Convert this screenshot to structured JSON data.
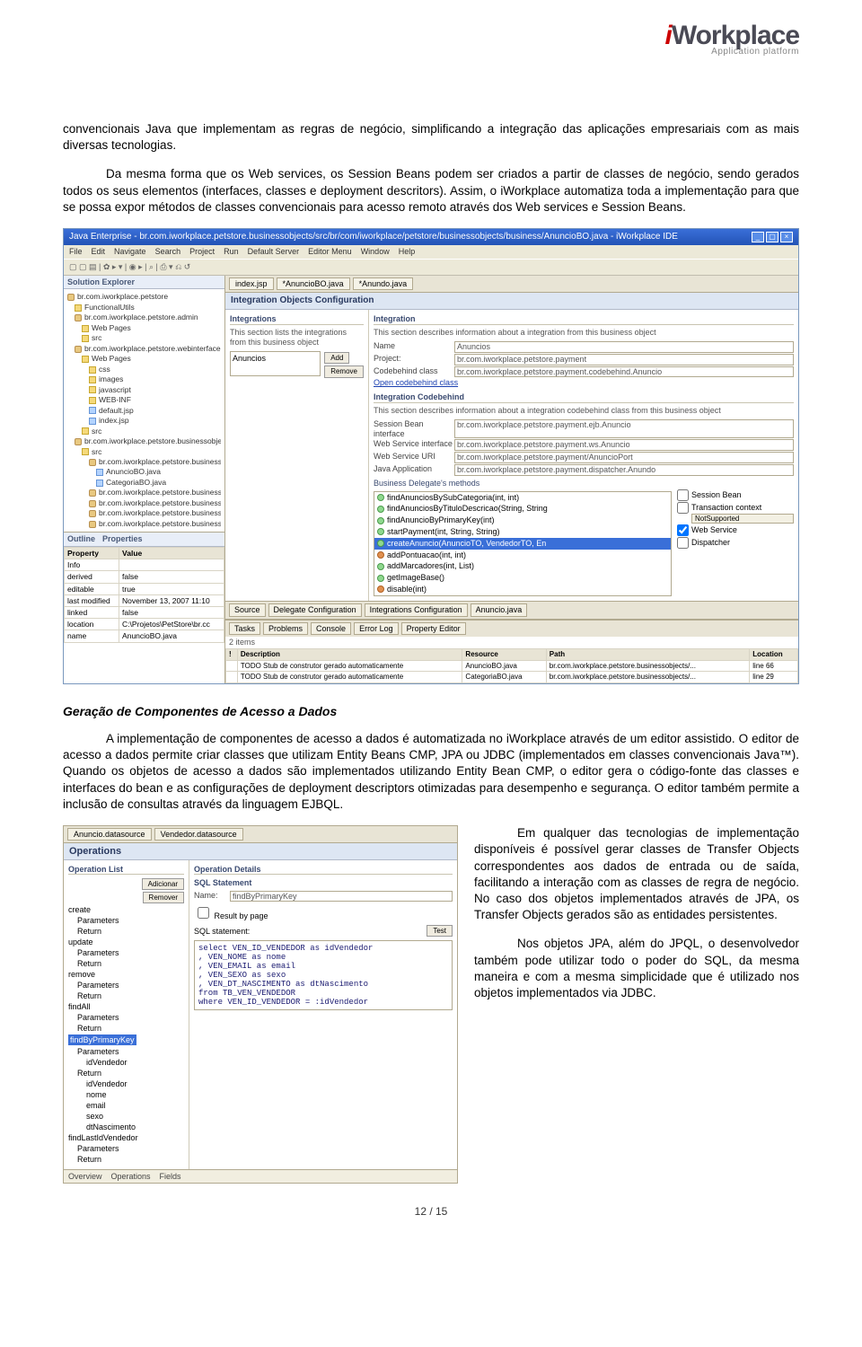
{
  "logo": {
    "text_i": "i",
    "text_rest": "Workplace",
    "sub": "Application   platform"
  },
  "para1": "convencionais Java que implementam as regras de negócio, simplificando a integração das aplicações empresariais com as mais diversas tecnologias.",
  "para2": "Da mesma forma que os Web services, os Session Beans podem ser criados a partir de classes de negócio, sendo gerados todos os seus elementos (interfaces, classes e deployment descritors). Assim, o iWorkplace automatiza toda a implementação para que se possa expor métodos de classes convencionais para acesso remoto através dos Web services e Session Beans.",
  "ide": {
    "title": "Java Enterprise - br.com.iworkplace.petstore.businessobjects/src/br/com/iworkplace/petstore/businessobjects/business/AnuncioBO.java - iWorkplace IDE",
    "menu": [
      "File",
      "Edit",
      "Navigate",
      "Search",
      "Project",
      "Run",
      "Default Server",
      "Editor Menu",
      "Window",
      "Help"
    ],
    "left_tab": "Solution Explorer",
    "tree": [
      {
        "d": 0,
        "ic": "pkg",
        "t": "br.com.iworkplace.petstore"
      },
      {
        "d": 1,
        "ic": "fld",
        "t": "FunctionalUtils"
      },
      {
        "d": 1,
        "ic": "pkg",
        "t": "br.com.iworkplace.petstore.admin"
      },
      {
        "d": 2,
        "ic": "fld",
        "t": "Web Pages"
      },
      {
        "d": 2,
        "ic": "fld",
        "t": "src"
      },
      {
        "d": 1,
        "ic": "pkg",
        "t": "br.com.iworkplace.petstore.webinterface"
      },
      {
        "d": 2,
        "ic": "fld",
        "t": "Web Pages"
      },
      {
        "d": 3,
        "ic": "fld",
        "t": "css"
      },
      {
        "d": 3,
        "ic": "fld",
        "t": "images"
      },
      {
        "d": 3,
        "ic": "fld",
        "t": "javascript"
      },
      {
        "d": 3,
        "ic": "fld",
        "t": "WEB-INF"
      },
      {
        "d": 3,
        "ic": "j",
        "t": "default.jsp"
      },
      {
        "d": 3,
        "ic": "j",
        "t": "index.jsp"
      },
      {
        "d": 2,
        "ic": "fld",
        "t": "src"
      },
      {
        "d": 1,
        "ic": "pkg",
        "t": "br.com.iworkplace.petstore.businessobjects"
      },
      {
        "d": 2,
        "ic": "fld",
        "t": "src"
      },
      {
        "d": 3,
        "ic": "pkg",
        "t": "br.com.iworkplace.petstore.businessob"
      },
      {
        "d": 4,
        "ic": "j",
        "t": "AnuncioBO.java"
      },
      {
        "d": 4,
        "ic": "j",
        "t": "CategoriaBO.java"
      },
      {
        "d": 3,
        "ic": "pkg",
        "t": "br.com.iworkplace.petstore.businessob"
      },
      {
        "d": 3,
        "ic": "pkg",
        "t": "br.com.iworkplace.petstore.businessob"
      },
      {
        "d": 3,
        "ic": "pkg",
        "t": "br.com.iworkplace.petstore.businessob"
      },
      {
        "d": 3,
        "ic": "pkg",
        "t": "br.com.iworkplace.petstore.businessob"
      }
    ],
    "props_tabs": [
      "Outline",
      "Properties"
    ],
    "props_head": [
      "Property",
      "Value"
    ],
    "props_rows": [
      [
        "Info",
        ""
      ],
      [
        "derived",
        "false"
      ],
      [
        "editable",
        "true"
      ],
      [
        "last modified",
        "November 13, 2007 11:10"
      ],
      [
        "linked",
        "false"
      ],
      [
        "location",
        "C:\\Projetos\\PetStore\\br.cc"
      ],
      [
        "name",
        "AnuncioBO.java"
      ]
    ],
    "ed_tabs": [
      "index.jsp",
      "*AnuncioBO.java",
      "*Anundo.java"
    ],
    "ed_title": "Integration Objects Configuration",
    "col1": {
      "h": "Integrations",
      "desc": "This section lists the integrations from this business object",
      "item": "Anuncios",
      "btn_add": "Add",
      "btn_remove": "Remove"
    },
    "col2": {
      "h1": "Integration",
      "desc1": "This section describes information about a integration from this business object",
      "r1": [
        "Name",
        "Anuncios"
      ],
      "r2": [
        "Project:",
        "br.com.iworkplace.petstore.payment"
      ],
      "r3": [
        "Codebehind class",
        "br.com.iworkplace.petstore.payment.codebehind.Anuncio"
      ],
      "open": "Open codebehind class",
      "h2": "Integration Codebehind",
      "desc2": "This section describes information about a integration codebehind class from this business object",
      "r4": [
        "Session Bean interface",
        "br.com.iworkplace.petstore.payment.ejb.Anuncio"
      ],
      "r5": [
        "Web Service interface",
        "br.com.iworkplace.petstore.payment.ws.Anuncio"
      ],
      "r6": [
        "Web Service URI",
        "br.com.iworkplace.petstore.payment/AnuncioPort"
      ],
      "r7": [
        "Java Application",
        "br.com.iworkplace.petstore.payment.dispatcher.Anundo"
      ],
      "h3": "Business Delegate's methods",
      "methods": [
        {
          "ic": "m",
          "t": "findAnunciosBySubCategoria(int, int)"
        },
        {
          "ic": "m",
          "t": "findAnunciosByTituloDescricao(String, String"
        },
        {
          "ic": "m",
          "t": "findAnuncioByPrimaryKey(int)"
        },
        {
          "ic": "m",
          "t": "startPayment(int, String, String)"
        },
        {
          "ic": "m",
          "t": "createAnuncio(AnuncioTO, VendedorTO, En",
          "sel": true
        },
        {
          "ic": "mr",
          "t": "addPontuacao(int, int)"
        },
        {
          "ic": "m",
          "t": "addMarcadores(int, List<Integer>)"
        },
        {
          "ic": "m",
          "t": "getImageBase()"
        },
        {
          "ic": "mr",
          "t": "disable(int)"
        }
      ],
      "cks": [
        {
          "l": "Session Bean",
          "c": false
        },
        {
          "l": "Transaction context",
          "c": false,
          "sub": "NotSupported"
        },
        {
          "l": "Web Service",
          "c": true
        },
        {
          "l": "Dispatcher",
          "c": false
        }
      ]
    },
    "bottom_tabs1": [
      "Source",
      "Delegate Configuration",
      "Integrations Configuration",
      "Anuncio.java"
    ],
    "bottom_tabs2": [
      "Tasks",
      "Problems",
      "Console",
      "Error Log",
      "Property Editor"
    ],
    "tasks_count": "2 items",
    "tasks_head": [
      "!",
      "Description",
      "Resource",
      "Path",
      "Location"
    ],
    "tasks_rows": [
      [
        "",
        "TODO Stub de construtor gerado automaticamente",
        "AnuncioBO.java",
        "br.com.iworkplace.petstore.businessobjects/...",
        "line 66"
      ],
      [
        "",
        "TODO Stub de construtor gerado automaticamente",
        "CategoriaBO.java",
        "br.com.iworkplace.petstore.businessobjects/...",
        "line 29"
      ]
    ]
  },
  "section_h": "Geração de Componentes de Acesso a Dados",
  "para3": "A implementação de componentes de acesso a dados é automatizada no iWorkplace através de um editor assistido. O editor de acesso a dados permite criar classes que utilizam Entity Beans CMP, JPA ou JDBC (implementados em classes convencionais Java™). Quando os objetos de acesso a dados são implementados utilizando Entity Bean CMP, o editor gera o código-fonte das classes e interfaces do bean e as configurações de deployment descriptors otimizadas para desempenho e segurança. O editor também permite a inclusão de consultas através da linguagem EJBQL.",
  "ds": {
    "tabs": [
      "Anuncio.datasource",
      "Vendedor.datasource"
    ],
    "title": "Operations",
    "left_h": "Operation List",
    "btn_add": "Adicionar",
    "btn_rem": "Remover",
    "tree": [
      {
        "l": 0,
        "t": "create"
      },
      {
        "l": 1,
        "t": "Parameters"
      },
      {
        "l": 1,
        "t": "Return"
      },
      {
        "l": 0,
        "t": "update"
      },
      {
        "l": 1,
        "t": "Parameters"
      },
      {
        "l": 1,
        "t": "Return"
      },
      {
        "l": 0,
        "t": "remove"
      },
      {
        "l": 1,
        "t": "Parameters"
      },
      {
        "l": 1,
        "t": "Return"
      },
      {
        "l": 0,
        "t": "findAll"
      },
      {
        "l": 1,
        "t": "Parameters"
      },
      {
        "l": 1,
        "t": "Return"
      },
      {
        "l": 0,
        "t": "findByPrimaryKey",
        "sel": true
      },
      {
        "l": 1,
        "t": "Parameters"
      },
      {
        "l": 2,
        "t": "idVendedor"
      },
      {
        "l": 1,
        "t": "Return"
      },
      {
        "l": 2,
        "t": "idVendedor"
      },
      {
        "l": 2,
        "t": "nome"
      },
      {
        "l": 2,
        "t": "email"
      },
      {
        "l": 2,
        "t": "sexo"
      },
      {
        "l": 2,
        "t": "dtNascimento"
      },
      {
        "l": 0,
        "t": "findLastIdVendedor"
      },
      {
        "l": 1,
        "t": "Parameters"
      },
      {
        "l": 1,
        "t": "Return"
      }
    ],
    "right_h": "Operation Details",
    "sql_h": "SQL Statement",
    "name_lbl": "Name:",
    "name_val": "findByPrimaryKey",
    "cb": "Result by page",
    "sql_lbl": "SQL statement:",
    "test": "Test",
    "sql": "select VEN_ID_VENDEDOR as idVendedor\n, VEN_NOME as nome\n, VEN_EMAIL as email\n, VEN_SEXO as sexo\n, VEN_DT_NASCIMENTO as dtNascimento\nfrom TB_VEN_VENDEDOR\nwhere VEN_ID_VENDEDOR = :idVendedor",
    "footer": [
      "Overview",
      "Operations",
      "Fields"
    ]
  },
  "side1": "Em qualquer das tecnologias de implementação disponíveis é possível gerar classes de Transfer Objects correspondentes aos dados de entrada ou de saída, facilitando a interação com as classes de regra de negócio. No caso dos objetos implementados através de JPA, os Transfer Objects gerados são as entidades persistentes.",
  "side2": "Nos objetos JPA, além do JPQL, o desenvolvedor também pode utilizar todo o poder do SQL, da mesma maneira e com a mesma simplicidade que é utilizado nos objetos implementados via JDBC.",
  "footer": "12 / 15"
}
